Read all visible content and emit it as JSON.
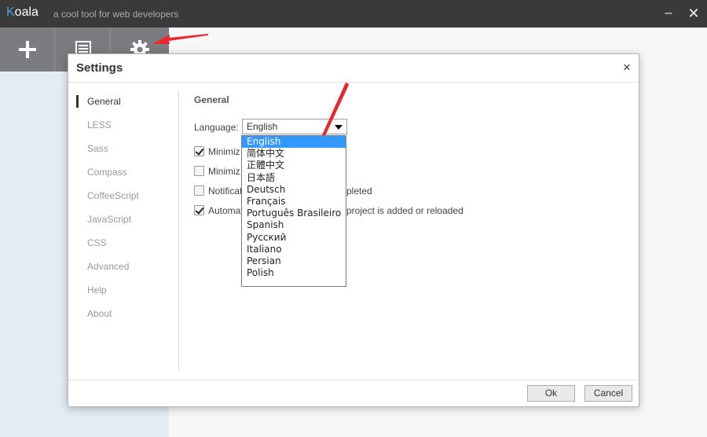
{
  "app": {
    "name_first": "K",
    "name_rest": "oala",
    "tagline": "a cool tool for web developers",
    "minimize": "–",
    "close": "✕"
  },
  "toolbar": {
    "add_icon": "plus-icon",
    "log_icon": "document-icon",
    "settings_icon": "gear-icon"
  },
  "dialog": {
    "title": "Settings",
    "close": "×",
    "nav": [
      "General",
      "LESS",
      "Sass",
      "Compass",
      "CoffeeScript",
      "JavaScript",
      "CSS",
      "Advanced",
      "Help",
      "About"
    ],
    "section_title": "General",
    "language_label": "Language:",
    "language_value": "English",
    "options": [
      {
        "left": "Minimiz",
        "right": "",
        "checked": true
      },
      {
        "left": "Minimiz",
        "right": "",
        "checked": false
      },
      {
        "left": "Notificat",
        "right": "pleted",
        "checked": false
      },
      {
        "left": "Automat",
        "right": "project is added or reloaded",
        "checked": true
      }
    ],
    "dropdown": [
      "English",
      "简体中文",
      "正體中文",
      "日本語",
      "Deutsch",
      "Français",
      "Português Brasileiro",
      "Spanish",
      "Русский",
      "Italiano",
      "Persian",
      "Polish"
    ],
    "ok": "Ok",
    "cancel": "Cancel"
  },
  "colors": {
    "accent": "#3399ff",
    "annotation": "#e8282d",
    "titlebar": "#3a3a3a",
    "toolbar": "#7a7c7f"
  }
}
